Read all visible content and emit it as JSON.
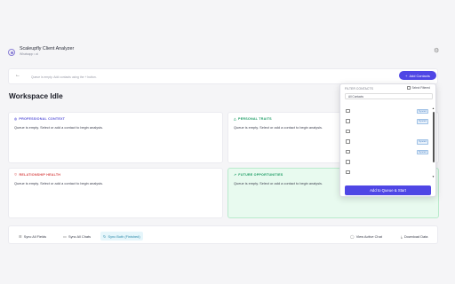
{
  "header": {
    "title": "Scaleupfly Client Analyzer",
    "subtitle": "Whatsapp • ai",
    "settings_icon": "gear-icon"
  },
  "search": {
    "placeholder": "Queue is empty. Add contacts using the + button.",
    "add_label": "Add Contacts"
  },
  "workspace": {
    "title": "Workspace Idle"
  },
  "cards": [
    {
      "title": "PROFESSIONAL CONTEXT",
      "icon": "◎",
      "body": "Queue is empty. Select or add a contact to begin analysis."
    },
    {
      "title": "PERSONAL TRAITS",
      "icon": "△",
      "body": "Queue is empty. Select or add a contact to begin analysis."
    },
    {
      "title": "RELATIONSHIP HEALTH",
      "icon": "♡",
      "body": "Queue is empty. Select or add a contact to begin analysis."
    },
    {
      "title": "FUTURE OPPORTUNITIES",
      "icon": "↗",
      "body": "Queue is empty. Select or add a contact to begin analysis."
    }
  ],
  "footer": {
    "sync_fields": "Sync All Fields",
    "sync_chats": "Sync All Chats",
    "sync_both": "Sync Both (Finished)",
    "view_chat": "View Active Chat",
    "download": "Download Data"
  },
  "dropdown": {
    "filter_label": "FILTER CONTACTS",
    "select_filtered": "Select Filtered",
    "filter_value": "All Contacts",
    "rows": [
      {
        "tag": "Synced"
      },
      {
        "tag": "Synced"
      },
      {
        "tag": ""
      },
      {
        "tag": "Synced"
      },
      {
        "tag": "Synced"
      },
      {
        "tag": ""
      },
      {
        "tag": ""
      }
    ],
    "action": "Add to Queue & Start"
  },
  "colors": {
    "accent": "#4f46e5",
    "professional": "#5b57d9",
    "personal": "#1f9d66",
    "relationship": "#d94a4a",
    "future_bg": "#e8faef"
  }
}
